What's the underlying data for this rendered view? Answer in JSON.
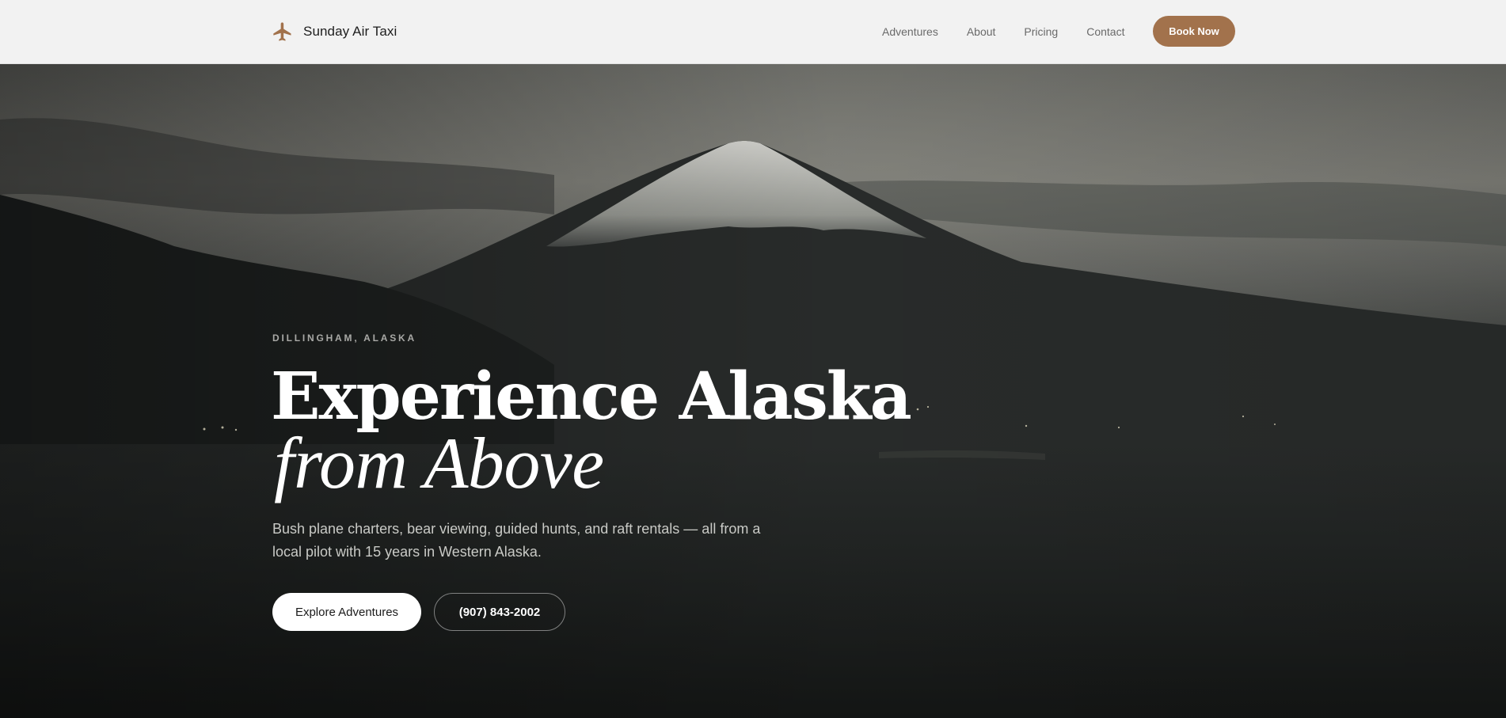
{
  "brand": {
    "name": "Sunday Air Taxi",
    "icon": "airplane-icon",
    "color": "#a2724c"
  },
  "nav": {
    "links": [
      "Adventures",
      "About",
      "Pricing",
      "Contact"
    ],
    "cta": "Book Now"
  },
  "hero": {
    "eyebrow": "DILLINGHAM, ALASKA",
    "headline_line1": "Experience Alaska",
    "headline_line2": "from Above",
    "subtext": "Bush plane charters, bear viewing, guided hunts, and raft rentals — all from a local pilot with 15 years in Western Alaska.",
    "primary_button": "Explore Adventures",
    "secondary_button": "(907) 843-2002"
  },
  "colors": {
    "accent": "#a2724c",
    "nav_background": "#f2f2f2",
    "hero_dark": "#1a1c1b"
  }
}
